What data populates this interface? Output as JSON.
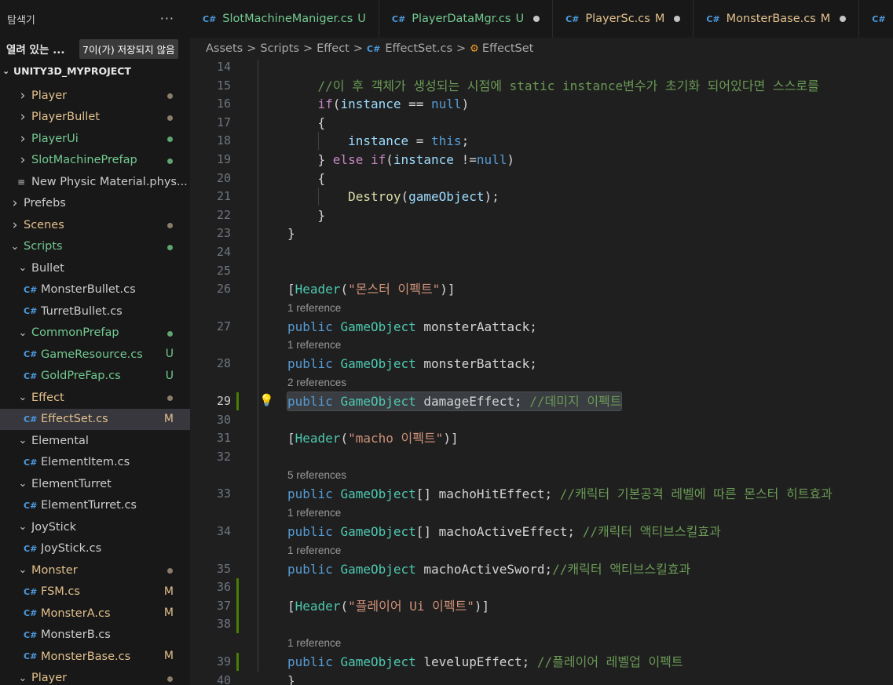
{
  "sidebar": {
    "title": "탐색기",
    "more": "···",
    "open_editors_label": "열려 있는 ...",
    "unsaved_badge": "7이(가) 저장되지 않음",
    "project_name": "UNITY3D_MYPROJECT",
    "tree": [
      {
        "label": "Player",
        "chev": "›",
        "color": "gold",
        "status": "dot-gray",
        "indent": 1,
        "icon": "chevron-right"
      },
      {
        "label": "PlayerBullet",
        "chev": "›",
        "color": "gold",
        "status": "dot-gray",
        "indent": 1,
        "icon": "chevron-right"
      },
      {
        "label": "PlayerUi",
        "chev": "›",
        "color": "green",
        "status": "dot-green",
        "indent": 1,
        "icon": "chevron-right"
      },
      {
        "label": "SlotMachinePrefap",
        "chev": "›",
        "color": "green",
        "status": "dot-green",
        "indent": 1,
        "icon": "chevron-right"
      },
      {
        "label": "New Physic Material.phys...",
        "chev": "≡",
        "color": "white",
        "status": "",
        "indent": 1,
        "icon": "file-lines-icon"
      },
      {
        "label": "Prefebs",
        "chev": "›",
        "color": "white",
        "status": "",
        "indent": 0,
        "icon": "chevron-right"
      },
      {
        "label": "Scenes",
        "chev": "›",
        "color": "gold",
        "status": "dot-gray",
        "indent": 0,
        "icon": "chevron-right"
      },
      {
        "label": "Scripts",
        "chev": "⌄",
        "color": "green",
        "status": "dot-green",
        "indent": 0,
        "icon": "chevron-down"
      },
      {
        "label": "Bullet",
        "chev": "⌄",
        "color": "white",
        "status": "",
        "indent": 1,
        "icon": "chevron-down"
      },
      {
        "label": "MonsterBullet.cs",
        "chev": "C#",
        "color": "white",
        "status": "",
        "indent": 2,
        "icon": "csharp-icon"
      },
      {
        "label": "TurretBullet.cs",
        "chev": "C#",
        "color": "white",
        "status": "",
        "indent": 2,
        "icon": "csharp-icon"
      },
      {
        "label": "CommonPrefap",
        "chev": "⌄",
        "color": "green",
        "status": "dot-green",
        "indent": 1,
        "icon": "chevron-down"
      },
      {
        "label": "GameResource.cs",
        "chev": "C#",
        "color": "green",
        "status": "U",
        "indent": 2,
        "icon": "csharp-icon"
      },
      {
        "label": "GoldPreFap.cs",
        "chev": "C#",
        "color": "green",
        "status": "U",
        "indent": 2,
        "icon": "csharp-icon"
      },
      {
        "label": "Effect",
        "chev": "⌄",
        "color": "gold",
        "status": "dot-gray",
        "indent": 1,
        "icon": "chevron-down"
      },
      {
        "label": "EffectSet.cs",
        "chev": "C#",
        "color": "gold",
        "status": "M",
        "indent": 2,
        "icon": "csharp-icon",
        "selected": true
      },
      {
        "label": "Elemental",
        "chev": "⌄",
        "color": "white",
        "status": "",
        "indent": 1,
        "icon": "chevron-down"
      },
      {
        "label": "ElementItem.cs",
        "chev": "C#",
        "color": "white",
        "status": "",
        "indent": 2,
        "icon": "csharp-icon"
      },
      {
        "label": "ElementTurret",
        "chev": "⌄",
        "color": "white",
        "status": "",
        "indent": 1,
        "icon": "chevron-down"
      },
      {
        "label": "ElementTurret.cs",
        "chev": "C#",
        "color": "white",
        "status": "",
        "indent": 2,
        "icon": "csharp-icon"
      },
      {
        "label": "JoyStick",
        "chev": "⌄",
        "color": "white",
        "status": "",
        "indent": 1,
        "icon": "chevron-down"
      },
      {
        "label": "JoyStick.cs",
        "chev": "C#",
        "color": "white",
        "status": "",
        "indent": 2,
        "icon": "csharp-icon"
      },
      {
        "label": "Monster",
        "chev": "⌄",
        "color": "gold",
        "status": "dot-gray",
        "indent": 1,
        "icon": "chevron-down"
      },
      {
        "label": "FSM.cs",
        "chev": "C#",
        "color": "gold",
        "status": "M",
        "indent": 2,
        "icon": "csharp-icon"
      },
      {
        "label": "MonsterA.cs",
        "chev": "C#",
        "color": "gold",
        "status": "M",
        "indent": 2,
        "icon": "csharp-icon"
      },
      {
        "label": "MonsterB.cs",
        "chev": "C#",
        "color": "white",
        "status": "",
        "indent": 2,
        "icon": "csharp-icon"
      },
      {
        "label": "MonsterBase.cs",
        "chev": "C#",
        "color": "gold",
        "status": "M",
        "indent": 2,
        "icon": "csharp-icon"
      },
      {
        "label": "Player",
        "chev": "⌄",
        "color": "gold",
        "status": "dot-gray",
        "indent": 1,
        "icon": "chevron-down"
      }
    ]
  },
  "tabs": [
    {
      "title": "SlotMachineManiger.cs",
      "status": "U",
      "kind": "u",
      "modified": false,
      "active": false
    },
    {
      "title": "PlayerDataMgr.cs",
      "status": "U",
      "kind": "u",
      "modified": true,
      "active": false
    },
    {
      "title": "PlayerSc.cs",
      "status": "M",
      "kind": "mod",
      "modified": true,
      "active": false
    },
    {
      "title": "MonsterBase.cs",
      "status": "M",
      "kind": "mod",
      "modified": true,
      "active": false
    },
    {
      "title": "",
      "status": "",
      "kind": "",
      "modified": false,
      "active": false
    }
  ],
  "breadcrumb": {
    "items": [
      "Assets",
      "Scripts",
      "Effect",
      "EffectSet.cs",
      "EffectSet"
    ],
    "separator": ">"
  },
  "editor": {
    "current_line": "29",
    "lines": [
      {
        "n": "14",
        "lens": "",
        "tokens": []
      },
      {
        "n": "15",
        "lens": "",
        "tokens": [
          [
            "t-com",
            "        //이 후 객체가 생성되는 시점에 static instance변수가 초기화 되어있다면 스스로를"
          ]
        ]
      },
      {
        "n": "16",
        "lens": "",
        "tokens": [
          [
            "t-plain",
            "        "
          ],
          [
            "t-ctl",
            "if"
          ],
          [
            "t-plain",
            "("
          ],
          [
            "t-var",
            "instance"
          ],
          [
            "t-plain",
            " == "
          ],
          [
            "t-kw",
            "null"
          ],
          [
            "t-plain",
            ")"
          ]
        ]
      },
      {
        "n": "17",
        "lens": "",
        "tokens": [
          [
            "t-plain",
            "        {"
          ]
        ]
      },
      {
        "n": "18",
        "lens": "",
        "tokens": [
          [
            "t-plain",
            "            "
          ],
          [
            "t-var",
            "instance"
          ],
          [
            "t-plain",
            " = "
          ],
          [
            "t-kw",
            "this"
          ],
          [
            "t-plain",
            ";"
          ]
        ]
      },
      {
        "n": "19",
        "lens": "",
        "tokens": [
          [
            "t-plain",
            "        } "
          ],
          [
            "t-ctl",
            "else"
          ],
          [
            "t-plain",
            " "
          ],
          [
            "t-ctl",
            "if"
          ],
          [
            "t-plain",
            "("
          ],
          [
            "t-var",
            "instance"
          ],
          [
            "t-plain",
            " !="
          ],
          [
            "t-kw",
            "null"
          ],
          [
            "t-plain",
            ")"
          ]
        ]
      },
      {
        "n": "20",
        "lens": "",
        "tokens": [
          [
            "t-plain",
            "        {"
          ]
        ]
      },
      {
        "n": "21",
        "lens": "",
        "tokens": [
          [
            "t-plain",
            "            "
          ],
          [
            "t-fn",
            "Destroy"
          ],
          [
            "t-plain",
            "("
          ],
          [
            "t-var",
            "gameObject"
          ],
          [
            "t-plain",
            ");"
          ]
        ]
      },
      {
        "n": "22",
        "lens": "",
        "tokens": [
          [
            "t-plain",
            "        }"
          ]
        ]
      },
      {
        "n": "23",
        "lens": "",
        "tokens": [
          [
            "t-plain",
            "    }"
          ]
        ]
      },
      {
        "n": "24",
        "lens": "",
        "tokens": []
      },
      {
        "n": "25",
        "lens": "",
        "tokens": []
      },
      {
        "n": "26",
        "lens": "",
        "tokens": [
          [
            "t-plain",
            "    ["
          ],
          [
            "t-type",
            "Header"
          ],
          [
            "t-plain",
            "("
          ],
          [
            "t-str",
            "\"몬스터 이펙트\""
          ],
          [
            "t-plain",
            ")]"
          ]
        ]
      },
      {
        "n": "27",
        "lens": "1 reference",
        "tokens": [
          [
            "t-kw",
            "    public"
          ],
          [
            "t-plain",
            " "
          ],
          [
            "t-type",
            "GameObject"
          ],
          [
            "t-plain",
            " monsterAattack;"
          ]
        ]
      },
      {
        "n": "28",
        "lens": "1 reference",
        "tokens": [
          [
            "t-kw",
            "    public"
          ],
          [
            "t-plain",
            " "
          ],
          [
            "t-type",
            "GameObject"
          ],
          [
            "t-plain",
            " monsterBattack;"
          ]
        ]
      },
      {
        "n": "29",
        "lens": "2 references",
        "tokens": [
          [
            "t-kw",
            "    public"
          ],
          [
            "t-plain",
            " "
          ],
          [
            "t-type",
            "GameObject"
          ],
          [
            "t-plain",
            " damageEffect; "
          ],
          [
            "t-com",
            "//데미지 이펙트"
          ]
        ]
      },
      {
        "n": "30",
        "lens": "",
        "tokens": []
      },
      {
        "n": "31",
        "lens": "",
        "tokens": [
          [
            "t-plain",
            "    ["
          ],
          [
            "t-type",
            "Header"
          ],
          [
            "t-plain",
            "("
          ],
          [
            "t-str",
            "\"macho 이펙트\""
          ],
          [
            "t-plain",
            ")]"
          ]
        ]
      },
      {
        "n": "32",
        "lens": "",
        "tokens": []
      },
      {
        "n": "33",
        "lens": "5 references",
        "tokens": [
          [
            "t-kw",
            "    public"
          ],
          [
            "t-plain",
            " "
          ],
          [
            "t-type",
            "GameObject"
          ],
          [
            "t-plain",
            "[] machoHitEffect; "
          ],
          [
            "t-com",
            "//캐릭터 기본공격 레벨에 따른 몬스터 히트효과"
          ]
        ]
      },
      {
        "n": "34",
        "lens": "1 reference",
        "tokens": [
          [
            "t-kw",
            "    public"
          ],
          [
            "t-plain",
            " "
          ],
          [
            "t-type",
            "GameObject"
          ],
          [
            "t-plain",
            "[] machoActiveEffect; "
          ],
          [
            "t-com",
            "//캐릭터 액티브스킬효과"
          ]
        ]
      },
      {
        "n": "35",
        "lens": "1 reference",
        "tokens": [
          [
            "t-kw",
            "    public"
          ],
          [
            "t-plain",
            " "
          ],
          [
            "t-type",
            "GameObject"
          ],
          [
            "t-plain",
            " machoActiveSword;"
          ],
          [
            "t-com",
            "//캐릭터 액티브스킬효과"
          ]
        ]
      },
      {
        "n": "36",
        "lens": "",
        "tokens": []
      },
      {
        "n": "37",
        "lens": "",
        "tokens": [
          [
            "t-plain",
            "    ["
          ],
          [
            "t-type",
            "Header"
          ],
          [
            "t-plain",
            "("
          ],
          [
            "t-str",
            "\"플레이어 Ui 이펙트\""
          ],
          [
            "t-plain",
            ")]"
          ]
        ]
      },
      {
        "n": "38",
        "lens": "",
        "tokens": []
      },
      {
        "n": "39",
        "lens": "1 reference",
        "tokens": [
          [
            "t-kw",
            "    public"
          ],
          [
            "t-plain",
            " "
          ],
          [
            "t-type",
            "GameObject"
          ],
          [
            "t-plain",
            " levelupEffect; "
          ],
          [
            "t-com",
            "//플레이어 레벨업 이펙트"
          ]
        ]
      },
      {
        "n": "40",
        "lens": "",
        "tokens": [
          [
            "t-plain",
            "}"
          ]
        ]
      }
    ]
  }
}
